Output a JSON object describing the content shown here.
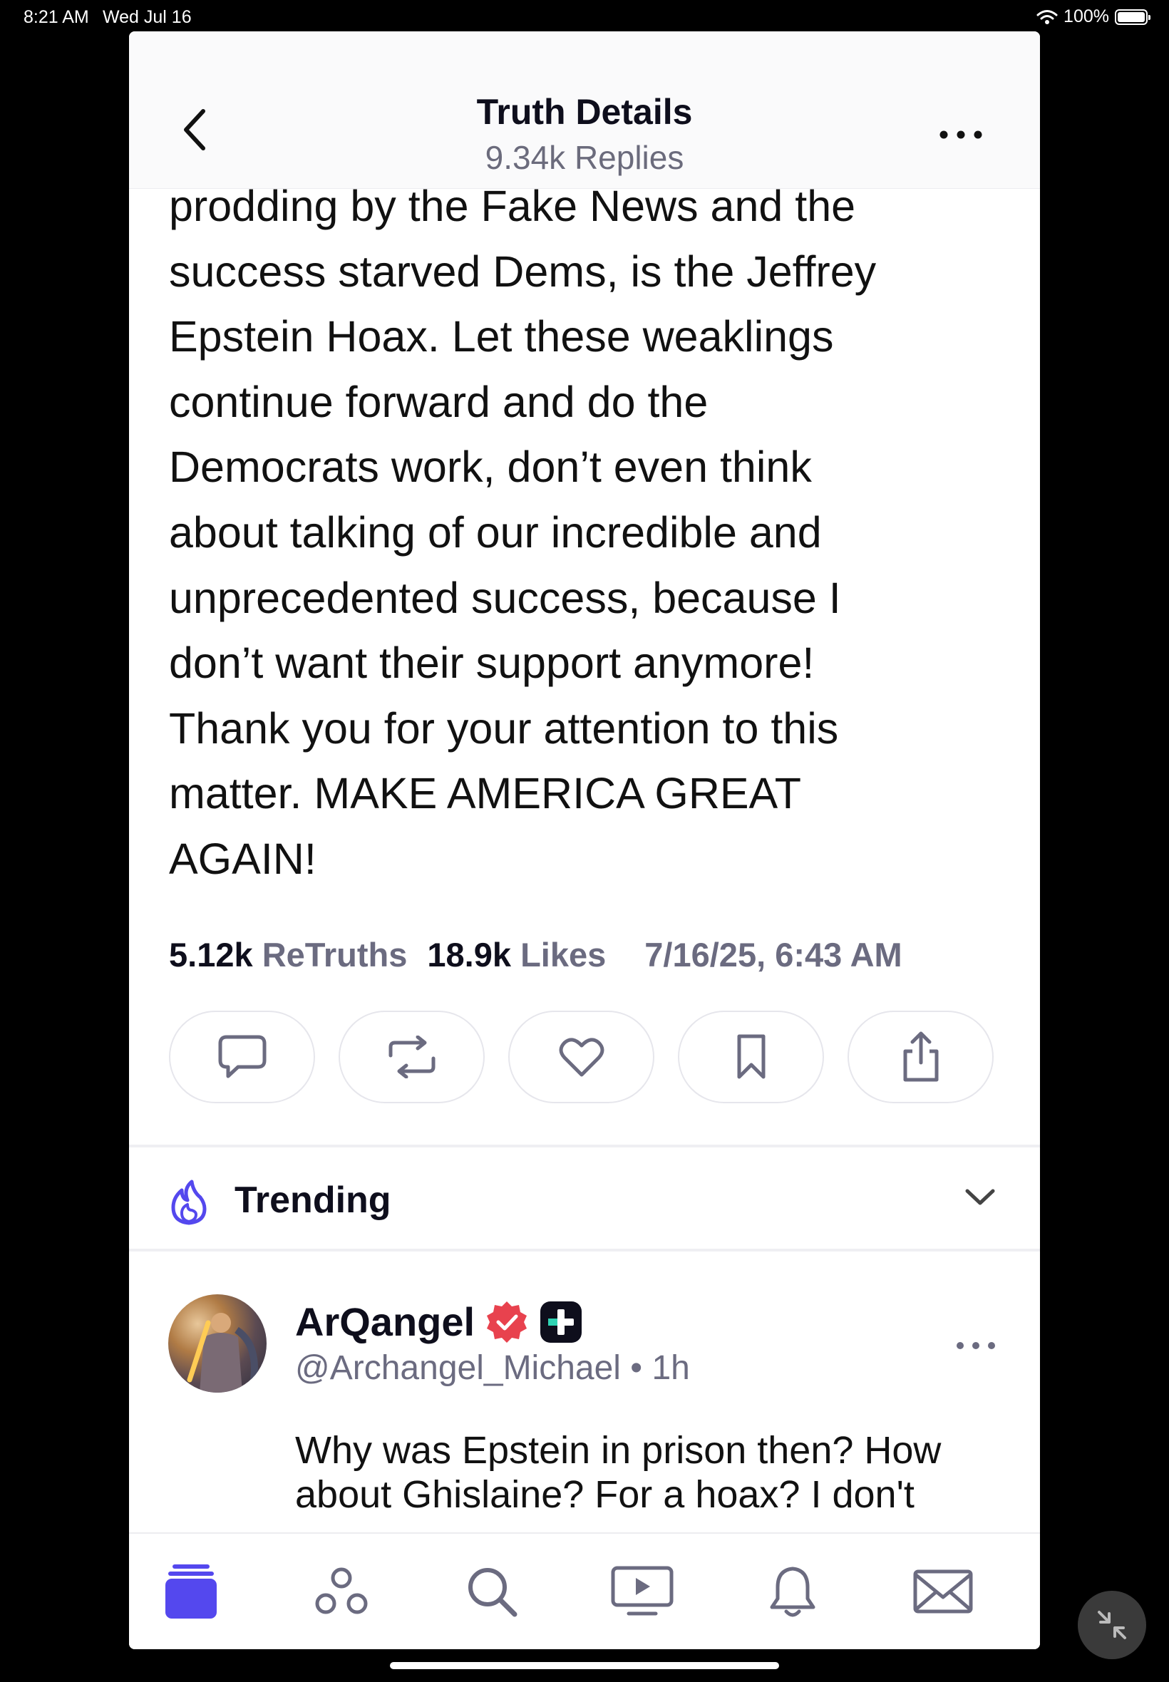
{
  "status_bar": {
    "time": "8:21 AM",
    "date": "Wed Jul 16",
    "battery": "100%",
    "battery_level": 1.0
  },
  "header": {
    "title": "Truth Details",
    "subtitle": "9.34k Replies"
  },
  "post": {
    "cut_line": "prodding by the Fake News and the",
    "lines": [
      "success starved Dems, is the Jeffrey",
      "Epstein Hoax. Let these weaklings",
      "continue forward and do the",
      "Democrats work, don’t even think",
      "about talking of our incredible and",
      "unprecedented success, because I",
      "don’t want their support anymore!",
      "Thank you for your attention to this",
      "matter. MAKE AMERICA GREAT",
      "AGAIN!"
    ],
    "stats": {
      "retruths_count": "5.12k",
      "retruths_label": "ReTruths",
      "likes_count": "18.9k",
      "likes_label": "Likes",
      "timestamp": "7/16/25, 6:43 AM"
    },
    "actions": [
      "reply-icon",
      "retruth-icon",
      "like-icon",
      "bookmark-icon",
      "share-icon"
    ]
  },
  "trending": {
    "label": "Trending"
  },
  "reply": {
    "name": "ArQangel",
    "handle": "@Archangel_Michael • 1h",
    "text": "Why was Epstein in prison then? How about Ghislaine? For a hoax? I don't"
  },
  "tabs": [
    "home-icon",
    "groups-icon",
    "search-icon",
    "video-icon",
    "notifications-icon",
    "messages-icon"
  ],
  "colors": {
    "accent": "#5448ee",
    "verified": "#e8424e",
    "muted": "#6b6b80"
  }
}
